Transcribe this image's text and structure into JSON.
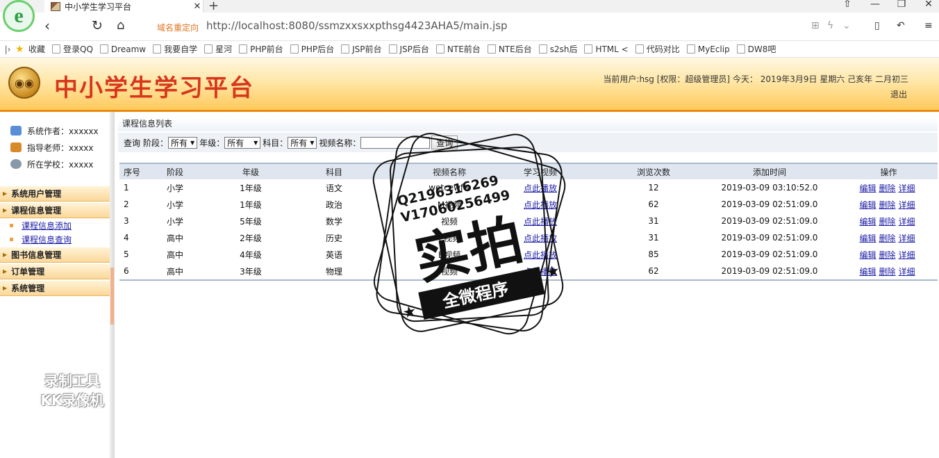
{
  "browser": {
    "tab_title": "中小学生学习平台",
    "redirect_label": "域名重定向",
    "url": "http://localhost:8080/ssmzxxsxxpthsg4423AHA5/main.jsp",
    "bookmarks": [
      {
        "label": "收藏",
        "icon": "star-icon"
      },
      {
        "label": "登录QQ",
        "icon": "qq-icon"
      },
      {
        "label": "Dreamw",
        "icon": "dreamweaver-icon"
      },
      {
        "label": "我要自学",
        "icon": "page-icon"
      },
      {
        "label": "星河",
        "icon": "page-icon"
      },
      {
        "label": "PHP前台",
        "icon": "page-icon"
      },
      {
        "label": "PHP后台",
        "icon": "page-icon"
      },
      {
        "label": "JSP前台",
        "icon": "page-icon"
      },
      {
        "label": "JSP后台",
        "icon": "page-icon"
      },
      {
        "label": "NTE前台",
        "icon": "page-icon"
      },
      {
        "label": "NTE后台",
        "icon": "page-icon"
      },
      {
        "label": "s2sh后",
        "icon": "page-icon"
      },
      {
        "label": "HTML <",
        "icon": "html5-icon"
      },
      {
        "label": "代码对比",
        "icon": "diff-icon"
      },
      {
        "label": "MyEclip",
        "icon": "myeclipse-icon"
      },
      {
        "label": "DW8吧",
        "icon": "paw-icon"
      }
    ]
  },
  "header": {
    "site_title": "中小学生学习平台",
    "user_info": "当前用户:hsg [权限：超级管理员] 今天： 2019年3月9日 星期六 己亥年 二月初三",
    "logout": "退出"
  },
  "sidebar": {
    "info": [
      {
        "label": "系统作者：xxxxxx",
        "color": "#5a8fd8"
      },
      {
        "label": "指导老师：xxxxx",
        "color": "#d68a2a"
      },
      {
        "label": "所在学校：xxxxx",
        "color": "#8899aa"
      }
    ],
    "groups": [
      {
        "label": "系统用户管理",
        "items": []
      },
      {
        "label": "课程信息管理",
        "items": [
          "课程信息添加",
          "课程信息查询"
        ]
      },
      {
        "label": "图书信息管理",
        "items": []
      },
      {
        "label": "订单管理",
        "items": []
      },
      {
        "label": "系统管理",
        "items": []
      }
    ]
  },
  "main": {
    "panel_title": "课程信息列表",
    "search": {
      "prefix": "查询",
      "stage_label": "阶段：",
      "stage_value": "所有",
      "grade_label": "年级：",
      "grade_value": "所有",
      "subject_label": "科目：",
      "subject_value": "所有",
      "video_name_label": "视频名称：",
      "video_name_value": "",
      "button": "查询"
    },
    "table": {
      "headers": [
        "序号",
        "阶段",
        "年级",
        "科目",
        "视频名称",
        "学习视频",
        "浏览次数",
        "添加时间",
        "操作"
      ],
      "rows": [
        {
          "idx": "1",
          "stage": "小学",
          "grade": "1年级",
          "subject": "语文",
          "name": "wetcewfw",
          "play": "点此播放",
          "views": "12",
          "time": "2019-03-09 03:10:52.0"
        },
        {
          "idx": "2",
          "stage": "小学",
          "grade": "1年级",
          "subject": "政治",
          "name": "M视频",
          "play": "点此播放",
          "views": "62",
          "time": "2019-03-09 02:51:09.0"
        },
        {
          "idx": "3",
          "stage": "小学",
          "grade": "5年级",
          "subject": "数学",
          "name": "视频",
          "play": "点此播放",
          "views": "31",
          "time": "2019-03-09 02:51:09.0"
        },
        {
          "idx": "4",
          "stage": "高中",
          "grade": "2年级",
          "subject": "历史",
          "name": "C视频",
          "play": "点此播放",
          "views": "31",
          "time": "2019-03-09 02:51:09.0"
        },
        {
          "idx": "5",
          "stage": "高中",
          "grade": "4年级",
          "subject": "英语",
          "name": "B视频",
          "play": "点此播放",
          "views": "85",
          "time": "2019-03-09 02:51:09.0"
        },
        {
          "idx": "6",
          "stage": "高中",
          "grade": "3年级",
          "subject": "物理",
          "name": "视频",
          "play": "点此播放",
          "views": "62",
          "time": "2019-03-09 02:51:09.0"
        }
      ],
      "ops": [
        "编辑",
        "删除",
        "详细"
      ]
    }
  },
  "watermarks": {
    "recorder_line1": "录制工具",
    "recorder_line2": "KK录像机",
    "stamp_contact_1": "Q2196316269",
    "stamp_contact_2": "V17060256499",
    "stamp_main": "实拍",
    "stamp_banner": "全微程序"
  }
}
